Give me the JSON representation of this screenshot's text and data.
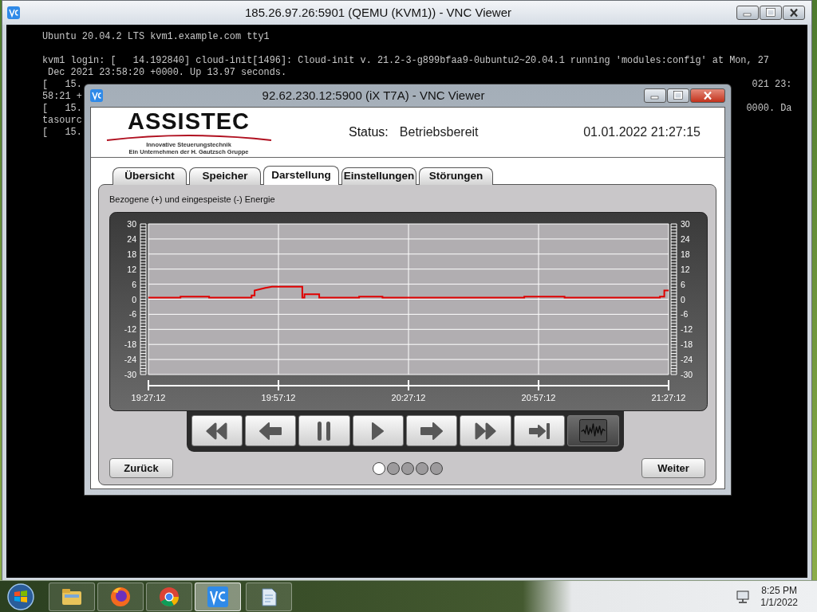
{
  "outer_window": {
    "title": "185.26.97.26:5901 (QEMU (KVM1)) - VNC Viewer"
  },
  "terminal": {
    "lines": [
      {
        "kind": "text",
        "left": "Ubuntu 20.04.2 LTS kvm1.example.com tty1"
      },
      {
        "kind": "blank"
      },
      {
        "kind": "text",
        "left": "kvm1 login: [   14.192840] cloud-init[1496]: Cloud-init v. 21.2-3-g899bfaa9-0ubuntu2~20.04.1 running 'modules:config' at Mon, 27"
      },
      {
        "kind": "text",
        "left": " Dec 2021 23:58:20 +0000. Up 13.97 seconds."
      },
      {
        "kind": "text",
        "left": "[   15.",
        "right": "021 23:"
      },
      {
        "kind": "text",
        "left": "58:21 +"
      },
      {
        "kind": "text",
        "left": "[   15.",
        "right": "0000. Da"
      },
      {
        "kind": "text",
        "left": "tasourc"
      },
      {
        "kind": "text",
        "left": "[   15."
      }
    ]
  },
  "vnc_window": {
    "title": "92.62.230.12:5900 (iX T7A) - VNC Viewer"
  },
  "header": {
    "logo": "ASSISTEC",
    "logo_tagline": "Innovative Steuerungstechnik",
    "logo_subline": "Ein Unternehmen der H. Gautzsch Gruppe",
    "status_label": "Status:",
    "status_value": "Betriebsbereit",
    "datetime": "01.01.2022 21:27:15"
  },
  "tabs": [
    {
      "label": "Übersicht",
      "selected": false
    },
    {
      "label": "Speicher",
      "selected": false
    },
    {
      "label": "Darstellung",
      "selected": true
    },
    {
      "label": "Einstellungen",
      "selected": false
    },
    {
      "label": "Störungen",
      "selected": false
    }
  ],
  "panel": {
    "caption": "Bezogene (+) und eingespeiste (-) Energie",
    "right_axis_labels": [
      "30",
      "24",
      "18",
      "12",
      "6",
      "0",
      "-6",
      "-12",
      "-18",
      "-24",
      "-30"
    ],
    "chart_data": {
      "type": "line",
      "grid": true,
      "x": [
        19.4533,
        19.5767,
        19.5767,
        19.6867,
        19.6867,
        19.85,
        19.85,
        19.8617,
        19.8617,
        19.9033,
        19.9283,
        20.045,
        20.045,
        20.0533,
        20.0533,
        20.11,
        20.11,
        20.2633,
        20.2633,
        20.3533,
        20.3533,
        20.8983,
        20.8983,
        21.0533,
        21.0533,
        21.42,
        21.42,
        21.4367,
        21.4367,
        21.4533
      ],
      "series": [
        {
          "color": "#e00000",
          "values": [
            0.6,
            0.6,
            1,
            1,
            0.6,
            0.6,
            1.5,
            1.5,
            3.5,
            4.5,
            5,
            5,
            0.6,
            0.6,
            2,
            2,
            0.6,
            0.6,
            1,
            1,
            0.6,
            0.6,
            1,
            1,
            0.6,
            0.6,
            1,
            1,
            3.5,
            3.5
          ]
        }
      ],
      "xlim": [
        19.4533,
        21.4533
      ],
      "ylim": [
        -30,
        30
      ],
      "xticks": [
        {
          "value": 19.4533,
          "label": "19:27:12"
        },
        {
          "value": 19.9533,
          "label": "19:57:12"
        },
        {
          "value": 20.4533,
          "label": "20:27:12"
        },
        {
          "value": 20.9533,
          "label": "20:57:12"
        },
        {
          "value": 21.4533,
          "label": "21:27:12"
        }
      ],
      "yticks": [
        30,
        24,
        18,
        12,
        6,
        0,
        -6,
        -12,
        -18,
        -24,
        -30
      ]
    }
  },
  "playback_buttons": [
    {
      "kind": "rewind",
      "selected": false
    },
    {
      "kind": "back",
      "selected": false
    },
    {
      "kind": "pause",
      "selected": false
    },
    {
      "kind": "play",
      "selected": false
    },
    {
      "kind": "forward",
      "selected": false
    },
    {
      "kind": "fast_forward",
      "selected": false
    },
    {
      "kind": "end",
      "selected": false
    },
    {
      "kind": "waveform",
      "selected": true
    }
  ],
  "nav": {
    "back": "Zurück",
    "next": "Weiter"
  },
  "pages": [
    {
      "selected": true
    },
    {
      "selected": false
    },
    {
      "selected": false
    },
    {
      "selected": false
    },
    {
      "selected": false
    }
  ],
  "taskbar": {
    "apps": [
      {
        "kind": "folder",
        "selected": false
      },
      {
        "kind": "firefox",
        "selected": false
      },
      {
        "kind": "chrome",
        "selected": false
      },
      {
        "kind": "vnc",
        "selected": true
      },
      {
        "kind": "notepad",
        "selected": false
      }
    ],
    "clock_time": "8:25 PM",
    "clock_date": "1/1/2022"
  }
}
